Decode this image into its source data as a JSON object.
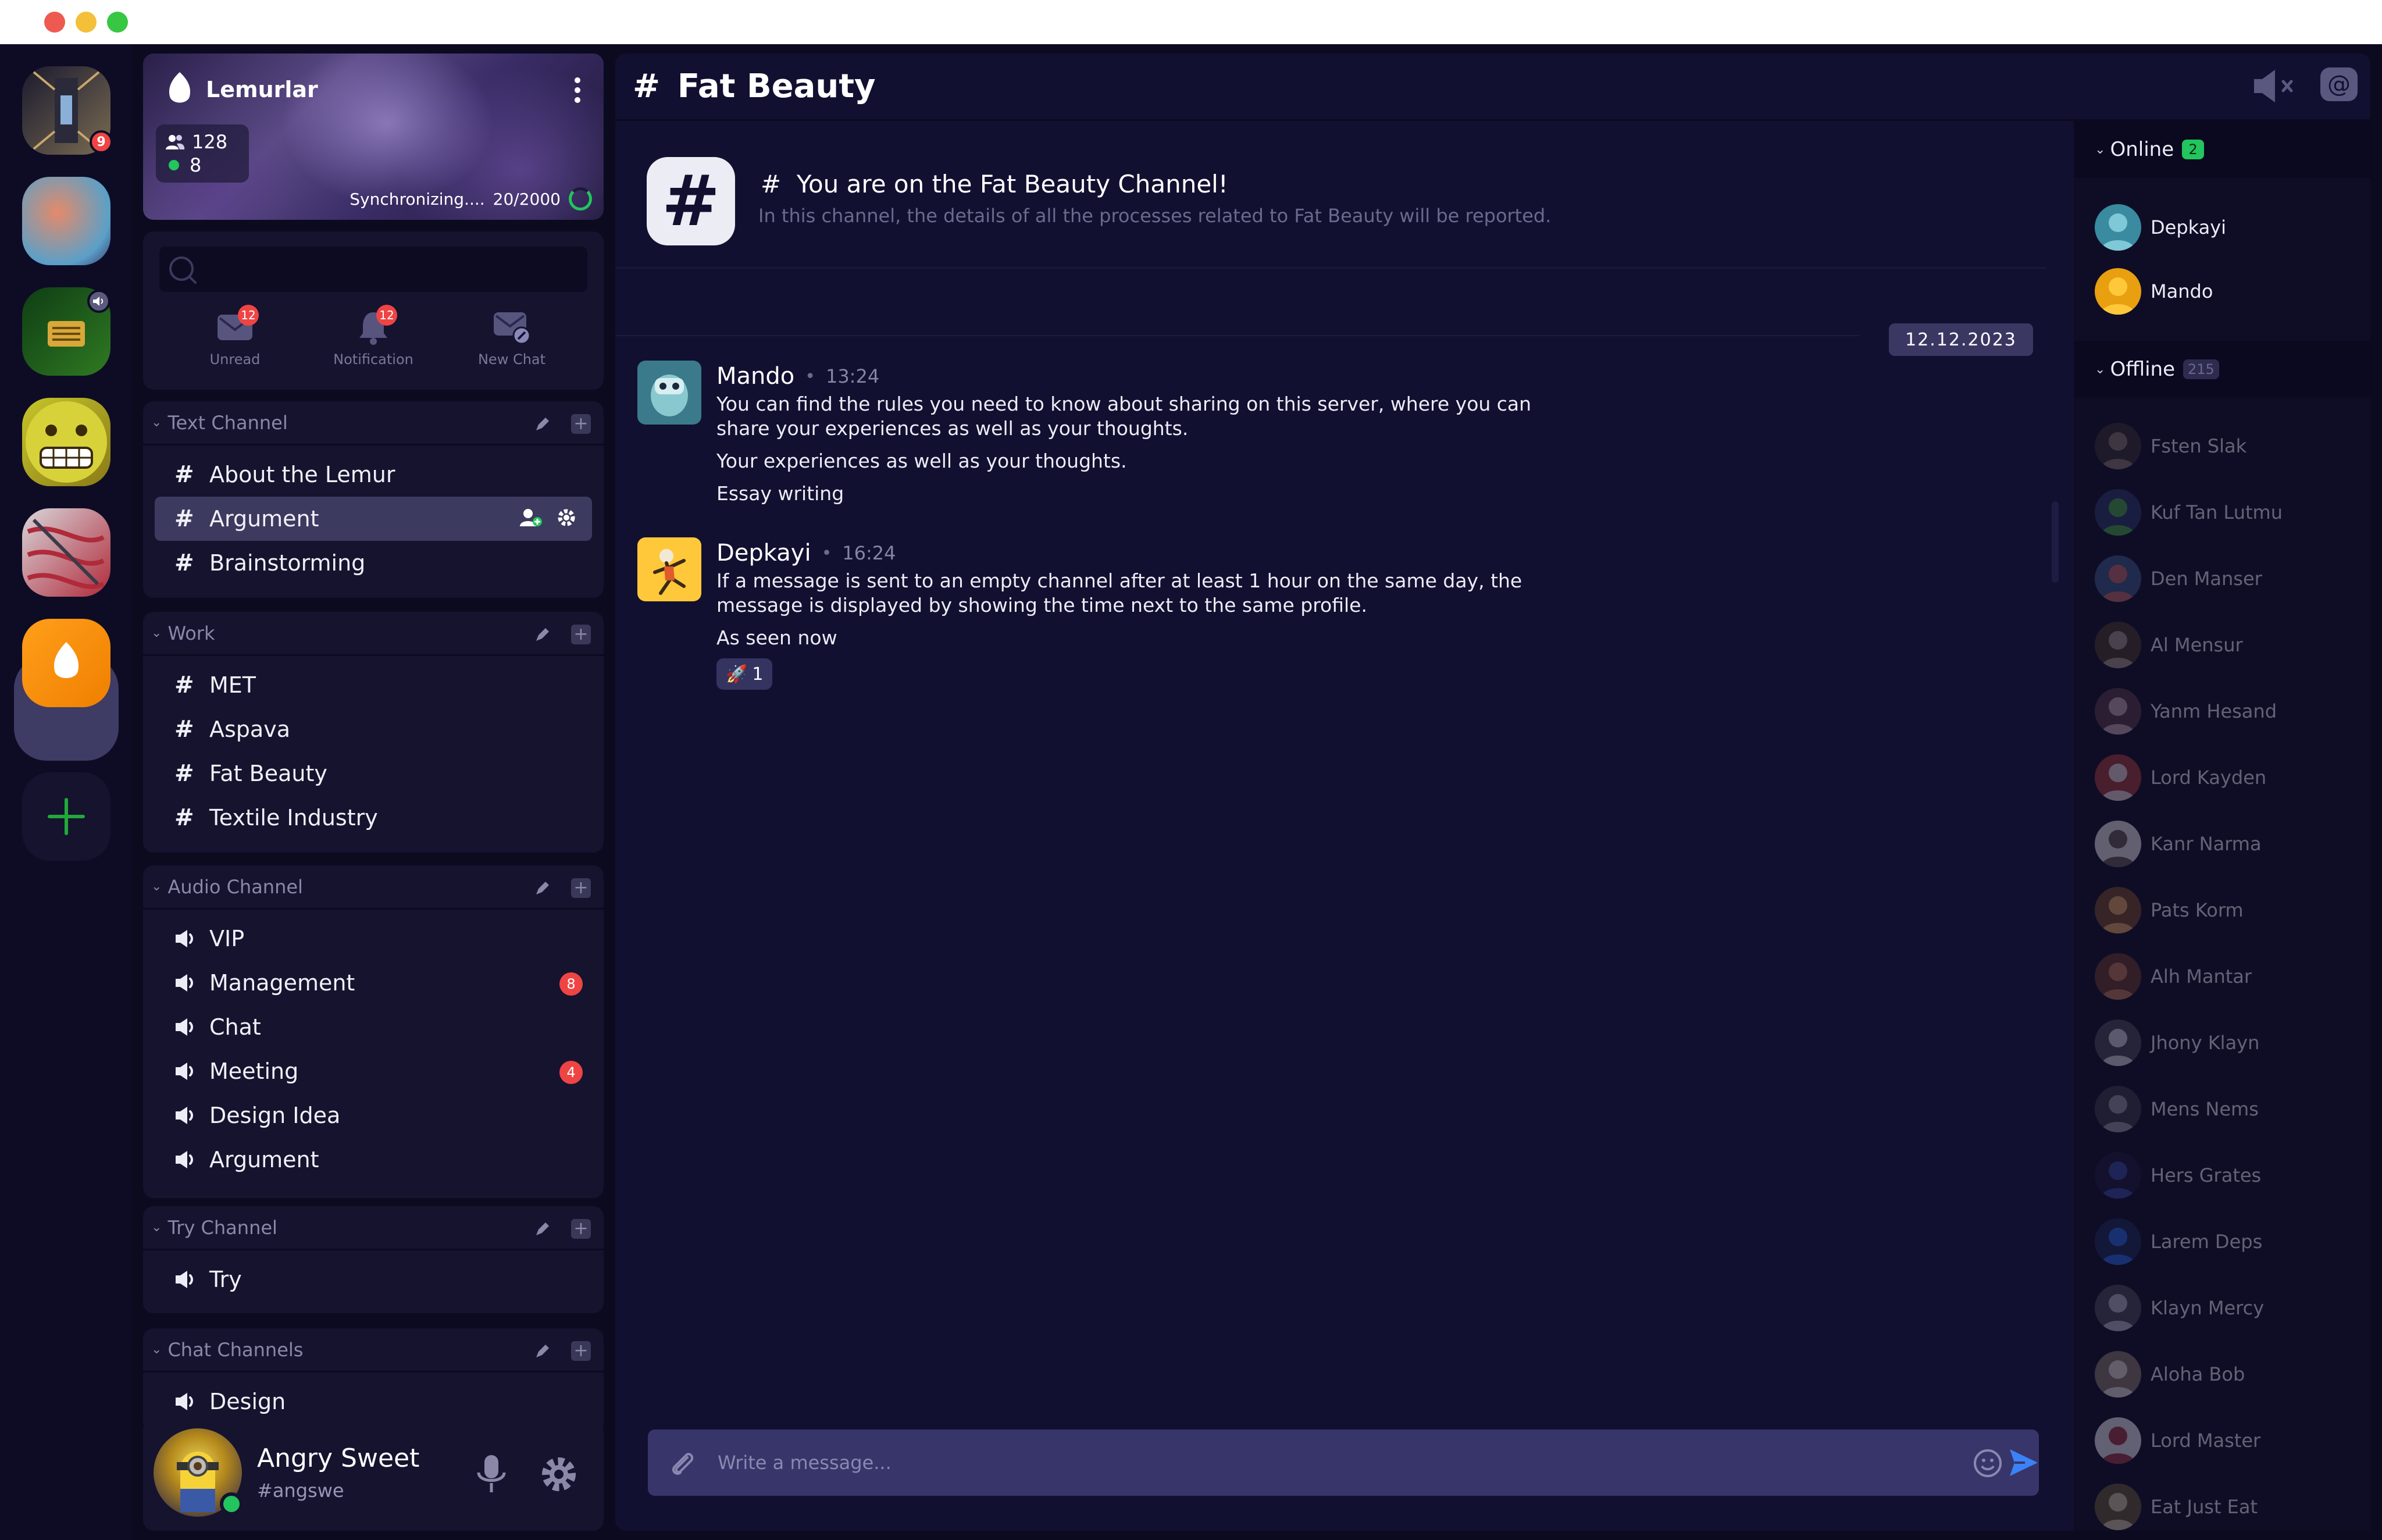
{
  "window": {
    "controls": [
      "close",
      "minimize",
      "maximize"
    ]
  },
  "rail": {
    "servers": [
      {
        "name": "server-corridor",
        "badge": "9",
        "colors": [
          "#1a1a2e",
          "#7a6b52"
        ]
      },
      {
        "name": "server-orb",
        "colors": [
          "#e58a6a",
          "#5aa0c8"
        ]
      },
      {
        "name": "server-green",
        "speaker": true,
        "colors": [
          "#0f3d14",
          "#2f7a22"
        ]
      },
      {
        "name": "server-emoji",
        "colors": [
          "#c6c52a",
          "#8a7a18"
        ]
      },
      {
        "name": "server-abstract",
        "colors": [
          "#d8d6da",
          "#b02a3a"
        ]
      },
      {
        "name": "server-lemurlar",
        "colors": [
          "#ff9f1a",
          "#f07f00"
        ],
        "active": true
      }
    ],
    "add_label": "+"
  },
  "server": {
    "name": "Lemurlar",
    "member_count": "128",
    "online_count": "8",
    "sync_text": "Synchronizing....",
    "sync_progress": "20/2000"
  },
  "quick": {
    "search_placeholder": "",
    "actions": [
      {
        "label": "Unread",
        "badge": "12"
      },
      {
        "label": "Notification",
        "badge": "12"
      },
      {
        "label": "New Chat"
      }
    ]
  },
  "groups": {
    "text": {
      "title": "Text Channel",
      "channels": [
        {
          "name": "About the Lemur"
        },
        {
          "name": "Argument",
          "active": true
        },
        {
          "name": "Brainstorming"
        }
      ]
    },
    "work": {
      "title": "Work",
      "channels": [
        {
          "name": "MET"
        },
        {
          "name": "Aspava"
        },
        {
          "name": "Fat Beauty"
        },
        {
          "name": "Textile Industry"
        }
      ]
    },
    "audio": {
      "title": "Audio Channel",
      "channels": [
        {
          "name": "VIP"
        },
        {
          "name": "Management",
          "badge": "8"
        },
        {
          "name": "Chat"
        },
        {
          "name": "Meeting",
          "badge": "4"
        },
        {
          "name": "Design Idea"
        },
        {
          "name": "Argument"
        }
      ]
    },
    "try": {
      "title": "Try Channel",
      "channels": [
        {
          "name": "Try"
        }
      ]
    },
    "chat": {
      "title": "Chat Channels",
      "channels": [
        {
          "name": "Design"
        }
      ]
    }
  },
  "user": {
    "name": "Angry Sweet",
    "handle": "#angswe"
  },
  "main": {
    "channel_title": "Fat Beauty",
    "hash": "#",
    "welcome_title": "You are on the Fat Beauty Channel!",
    "welcome_sub": "In this channel, the details of all the processes related to Fat Beauty will be reported.",
    "date": "12.12.2023",
    "composer_placeholder": "Write a message..."
  },
  "messages": [
    {
      "author": "Mando",
      "time": "13:24",
      "lines": [
        "You can find the rules you need to know about sharing on this server, where you can share your experiences as well as your thoughts.",
        "Your experiences as well as your thoughts.",
        "Essay writing"
      ]
    },
    {
      "author": "Depkayi",
      "time": "16:24",
      "lines": [
        "If a message is sent to an empty channel after at least 1 hour on the same day, the message is displayed by showing the time next to the same profile.",
        "As seen now"
      ],
      "reaction": {
        "emoji": "🚀",
        "count": "1"
      }
    }
  ],
  "members": {
    "online_title": "Online",
    "online_count": "2",
    "offline_title": "Offline",
    "offline_count": "215",
    "online": [
      {
        "name": "Depkayi",
        "colors": [
          "#7ec8d8",
          "#3a8aa0"
        ]
      },
      {
        "name": "Mando",
        "colors": [
          "#ffc83a",
          "#e8a010"
        ]
      }
    ],
    "offline": [
      {
        "name": "Fsten Slak",
        "colors": [
          "#8a7a6a",
          "#3a3030"
        ]
      },
      {
        "name": "Kuf Tan Lutmu",
        "colors": [
          "#4aa84a",
          "#2a3a6a"
        ]
      },
      {
        "name": "Den Manser",
        "colors": [
          "#c86a6a",
          "#3a5a8a"
        ]
      },
      {
        "name": "Al Mensur",
        "colors": [
          "#a89a8a",
          "#4a3a2a"
        ]
      },
      {
        "name": "Yanm Hesand",
        "colors": [
          "#c8a8b8",
          "#5a3a4a"
        ]
      },
      {
        "name": "Lord Kayden",
        "colors": [
          "#e8d8d8",
          "#a83a3a"
        ]
      },
      {
        "name": "Kanr Narma",
        "colors": [
          "#6a5a5a",
          "#e8e8e8"
        ]
      },
      {
        "name": "Pats Korm",
        "colors": [
          "#e8a860",
          "#7a4a2a"
        ]
      },
      {
        "name": "Alh Mantar",
        "colors": [
          "#c87a5a",
          "#6a3a2a"
        ]
      },
      {
        "name": "Jhony Klayn",
        "colors": [
          "#d8d8e0",
          "#4a4a5a"
        ]
      },
      {
        "name": "Mens Nems",
        "colors": [
          "#9898a8",
          "#3a3a4a"
        ]
      },
      {
        "name": "Hers Grates",
        "colors": [
          "#3a4aa8",
          "#1a1a3a"
        ]
      },
      {
        "name": "Larem Deps",
        "colors": [
          "#2a6ae8",
          "#1a2a5a"
        ]
      },
      {
        "name": "Klayn Mercy",
        "colors": [
          "#b8b8c8",
          "#4a4a5a"
        ]
      },
      {
        "name": "Aloha Bob",
        "colors": [
          "#e8e0d8",
          "#8a7a6a"
        ]
      },
      {
        "name": "Lord Master",
        "colors": [
          "#a83a4a",
          "#e8e8f0"
        ]
      },
      {
        "name": "Eat Just Eat",
        "colors": [
          "#d8c8a8",
          "#6a5a3a"
        ]
      }
    ]
  }
}
